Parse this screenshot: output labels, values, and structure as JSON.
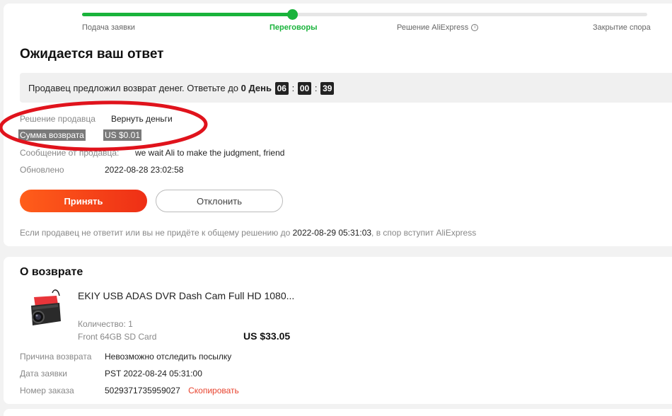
{
  "progress": {
    "steps": [
      "Подача заявки",
      "Переговоры",
      "Решение AliExpress",
      "Закрытие спора"
    ],
    "active_index": 1,
    "info_glyph": "i",
    "fill_fraction": 0.373,
    "accent": "#19b33b"
  },
  "response": {
    "title": "Ожидается ваш ответ",
    "notice_prefix": "Продавец предложил возврат денег. Ответьте до",
    "days_count": "0",
    "days_word": "День",
    "hours": "06",
    "minutes": "00",
    "seconds": "39",
    "colon": ":",
    "seller_decision_label": "Решение продавца",
    "seller_decision_value": "Вернуть деньги",
    "refund_amount_label": "Сумма возврата",
    "refund_amount_value": "US $0.01",
    "seller_message_label": "Сообщение от продавца:",
    "seller_message_value": "we wait Ali to make the judgment, friend",
    "updated_label": "Обновлено",
    "updated_value": "2022-08-28 23:02:58",
    "accept_label": "Принять",
    "reject_label": "Отклонить",
    "footnote_prefix": "Если продавец не ответит или вы не придёте к общему решению до",
    "footnote_date": "2022-08-29 05:31:03",
    "footnote_suffix": ", в спор вступит AliExpress",
    "accent_button": "#ff4a17",
    "annotation_color": "#e0131c"
  },
  "refund": {
    "title": "О возврате",
    "product_title": "EKIY USB ADAS DVR Dash Cam Full HD 1080...",
    "quantity": "Количество: 1",
    "variant": "Front 64GB SD Card",
    "price": "US $33.05",
    "reason_label": "Причина возврата",
    "reason_value": "Невозможно отследить посылку",
    "request_date_label": "Дата заявки",
    "request_date_value": "PST 2022-08-24 05:31:00",
    "order_number_label": "Номер заказа",
    "order_number_value": "5029371735959027",
    "copy_label": "Скопировать"
  }
}
